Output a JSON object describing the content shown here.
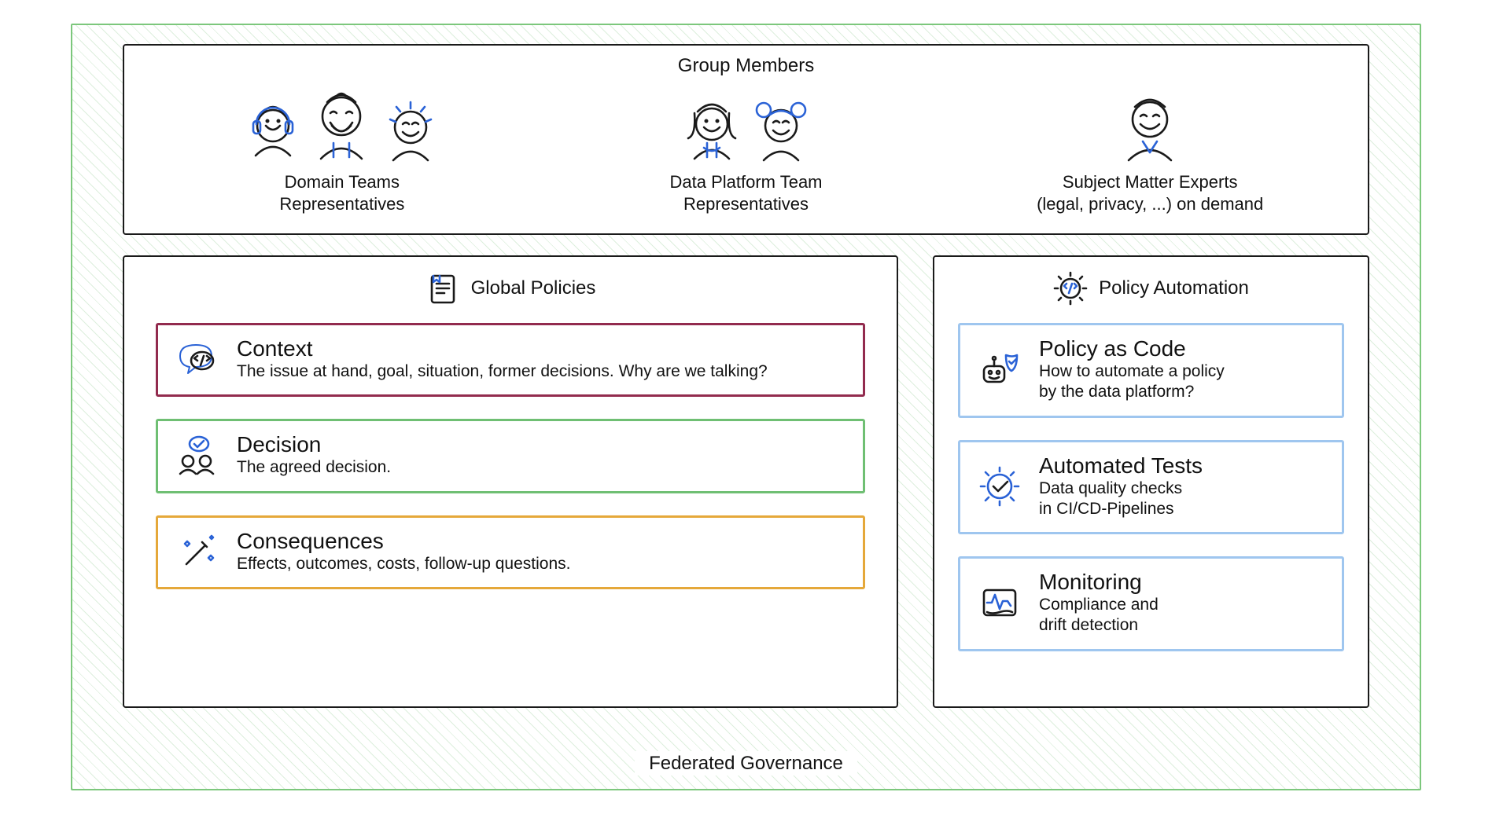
{
  "frame": {
    "label": "Federated Governance"
  },
  "members": {
    "title": "Group Members",
    "groups": [
      {
        "label": "Domain Teams\nRepresentatives"
      },
      {
        "label": "Data Platform Team\nRepresentatives"
      },
      {
        "label": "Subject Matter Experts\n(legal, privacy, ...) on demand"
      }
    ]
  },
  "policies": {
    "title": "Global Policies",
    "cards": [
      {
        "head": "Context",
        "sub": "The issue at hand, goal, situation, former decisions. Why are we talking?",
        "color": "maroon"
      },
      {
        "head": "Decision",
        "sub": "The agreed decision.",
        "color": "green"
      },
      {
        "head": "Consequences",
        "sub": "Effects, outcomes, costs, follow-up questions.",
        "color": "amber"
      }
    ]
  },
  "automation": {
    "title": "Policy Automation",
    "cards": [
      {
        "head": "Policy as Code",
        "sub": "How to automate a policy\nby the data platform?",
        "color": "blue"
      },
      {
        "head": "Automated Tests",
        "sub": "Data quality checks\nin CI/CD-Pipelines",
        "color": "blue"
      },
      {
        "head": "Monitoring",
        "sub": "Compliance and\ndrift detection",
        "color": "blue"
      }
    ]
  }
}
